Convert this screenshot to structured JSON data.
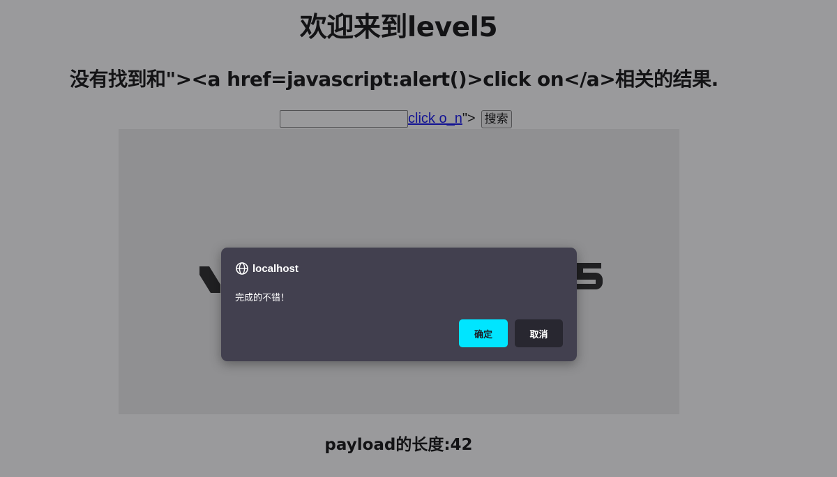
{
  "page": {
    "heading": "欢迎来到level5",
    "result_message": "没有找到和\"><a href=javascript:alert()>click on</a>相关的结果.",
    "search": {
      "value": "",
      "injected_link_text": "click o_n",
      "trailing_text": "\">",
      "button_label": "搜索"
    },
    "payload_length_text": "payload的长度:42"
  },
  "dialog": {
    "origin": "localhost",
    "origin_icon": "globe-icon",
    "message": "完成的不错！",
    "ok_label": "确定",
    "cancel_label": "取消"
  },
  "colors": {
    "dialog_background": "#42404f",
    "ok_button": "#00e5ff",
    "cancel_button": "#282730",
    "link": "#0000ee"
  }
}
